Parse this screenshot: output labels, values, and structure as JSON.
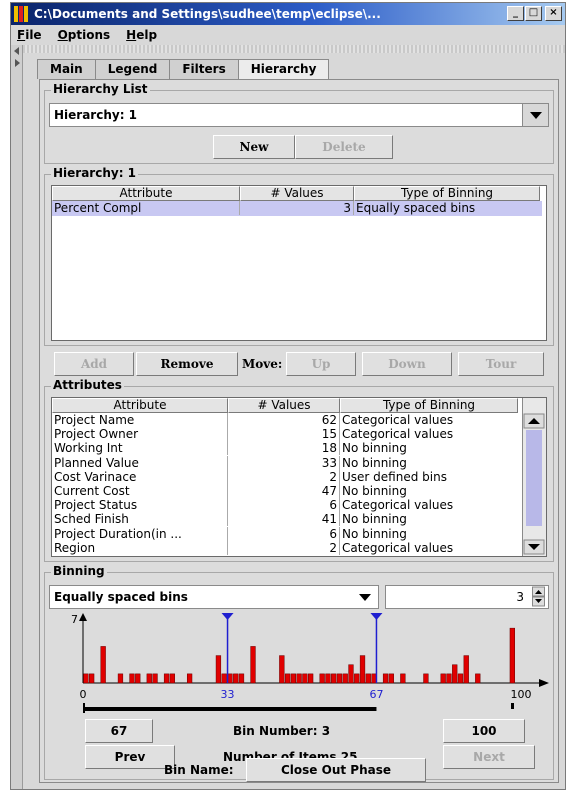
{
  "window": {
    "title": "C:\\Documents and Settings\\sudhee\\temp\\eclipse\\...",
    "controls": [
      "_",
      "□",
      "×"
    ]
  },
  "menu": [
    {
      "mnemonic": "F",
      "rest": "ile"
    },
    {
      "mnemonic": "O",
      "rest": "ptions"
    },
    {
      "mnemonic": "H",
      "rest": "elp"
    }
  ],
  "tabs": [
    "Main",
    "Legend",
    "Filters",
    "Hierarchy"
  ],
  "active_tab": "Hierarchy",
  "hierarchy_list": {
    "title": "Hierarchy List",
    "selected": "Hierarchy: 1",
    "new_label": "New",
    "delete_label": "Delete"
  },
  "hierarchy": {
    "title": "Hierarchy: 1",
    "columns": [
      "Attribute",
      "# Values",
      "Type of Binning"
    ],
    "rows": [
      {
        "attribute": "Percent Compl",
        "values": "3",
        "binning": "Equally spaced bins"
      }
    ]
  },
  "actions": {
    "add": "Add",
    "remove": "Remove",
    "move_label": "Move:",
    "up": "Up",
    "down": "Down",
    "tour": "Tour"
  },
  "attributes": {
    "title": "Attributes",
    "columns": [
      "Attribute",
      "# Values",
      "Type of Binning"
    ],
    "rows": [
      {
        "attribute": "Project Name",
        "values": "62",
        "binning": "Categorical values"
      },
      {
        "attribute": "Project Owner",
        "values": "15",
        "binning": "Categorical values"
      },
      {
        "attribute": "Working Int",
        "values": "18",
        "binning": "No binning"
      },
      {
        "attribute": "Planned Value",
        "values": "33",
        "binning": "No binning"
      },
      {
        "attribute": "Cost Varinace",
        "values": "2",
        "binning": "User defined bins"
      },
      {
        "attribute": "Current Cost",
        "values": "47",
        "binning": "No binning"
      },
      {
        "attribute": "Project Status",
        "values": "6",
        "binning": "Categorical values"
      },
      {
        "attribute": "Sched Finish",
        "values": "41",
        "binning": "No binning"
      },
      {
        "attribute": "Project Duration(in ...",
        "values": "6",
        "binning": "No binning"
      },
      {
        "attribute": "Region",
        "values": "2",
        "binning": "Categorical values"
      }
    ]
  },
  "binning": {
    "title": "Binning",
    "method": "Equally spaced bins",
    "bin_count": "3",
    "histogram": {
      "y_max_label": "7",
      "x_min": 0,
      "x_max": 100,
      "x_min_label": "0",
      "x_max_label": "100",
      "bins": [
        1,
        1,
        0,
        4,
        0,
        0,
        1,
        0,
        1,
        1,
        0,
        1,
        1,
        0,
        1,
        1,
        0,
        0,
        1,
        0,
        0,
        0,
        0,
        3,
        1,
        1,
        1,
        1,
        0,
        4,
        0,
        0,
        0,
        0,
        3,
        1,
        1,
        1,
        1,
        1,
        0,
        1,
        1,
        1,
        1,
        1,
        2,
        1,
        3,
        1,
        1,
        0,
        1,
        1,
        0,
        1,
        0,
        0,
        0,
        1,
        0,
        0,
        1,
        1,
        2,
        1,
        3,
        0,
        1,
        0,
        0,
        0,
        0,
        0,
        6,
        0
      ],
      "markers": [
        {
          "value": 33,
          "label": "33"
        },
        {
          "value": 67,
          "label": "67"
        }
      ],
      "bar_color": "#e00000",
      "marker_color": "#1f1fd0"
    },
    "range": {
      "low": 67,
      "high": 100
    },
    "low_value": "67",
    "high_value": "100",
    "bin_number_label": "Bin Number: 3",
    "items_label": "Number of Items 25",
    "prev_label": "Prev",
    "next_label": "Next",
    "bin_name_label": "Bin Name:",
    "bin_name_value": "Close Out Phase"
  }
}
